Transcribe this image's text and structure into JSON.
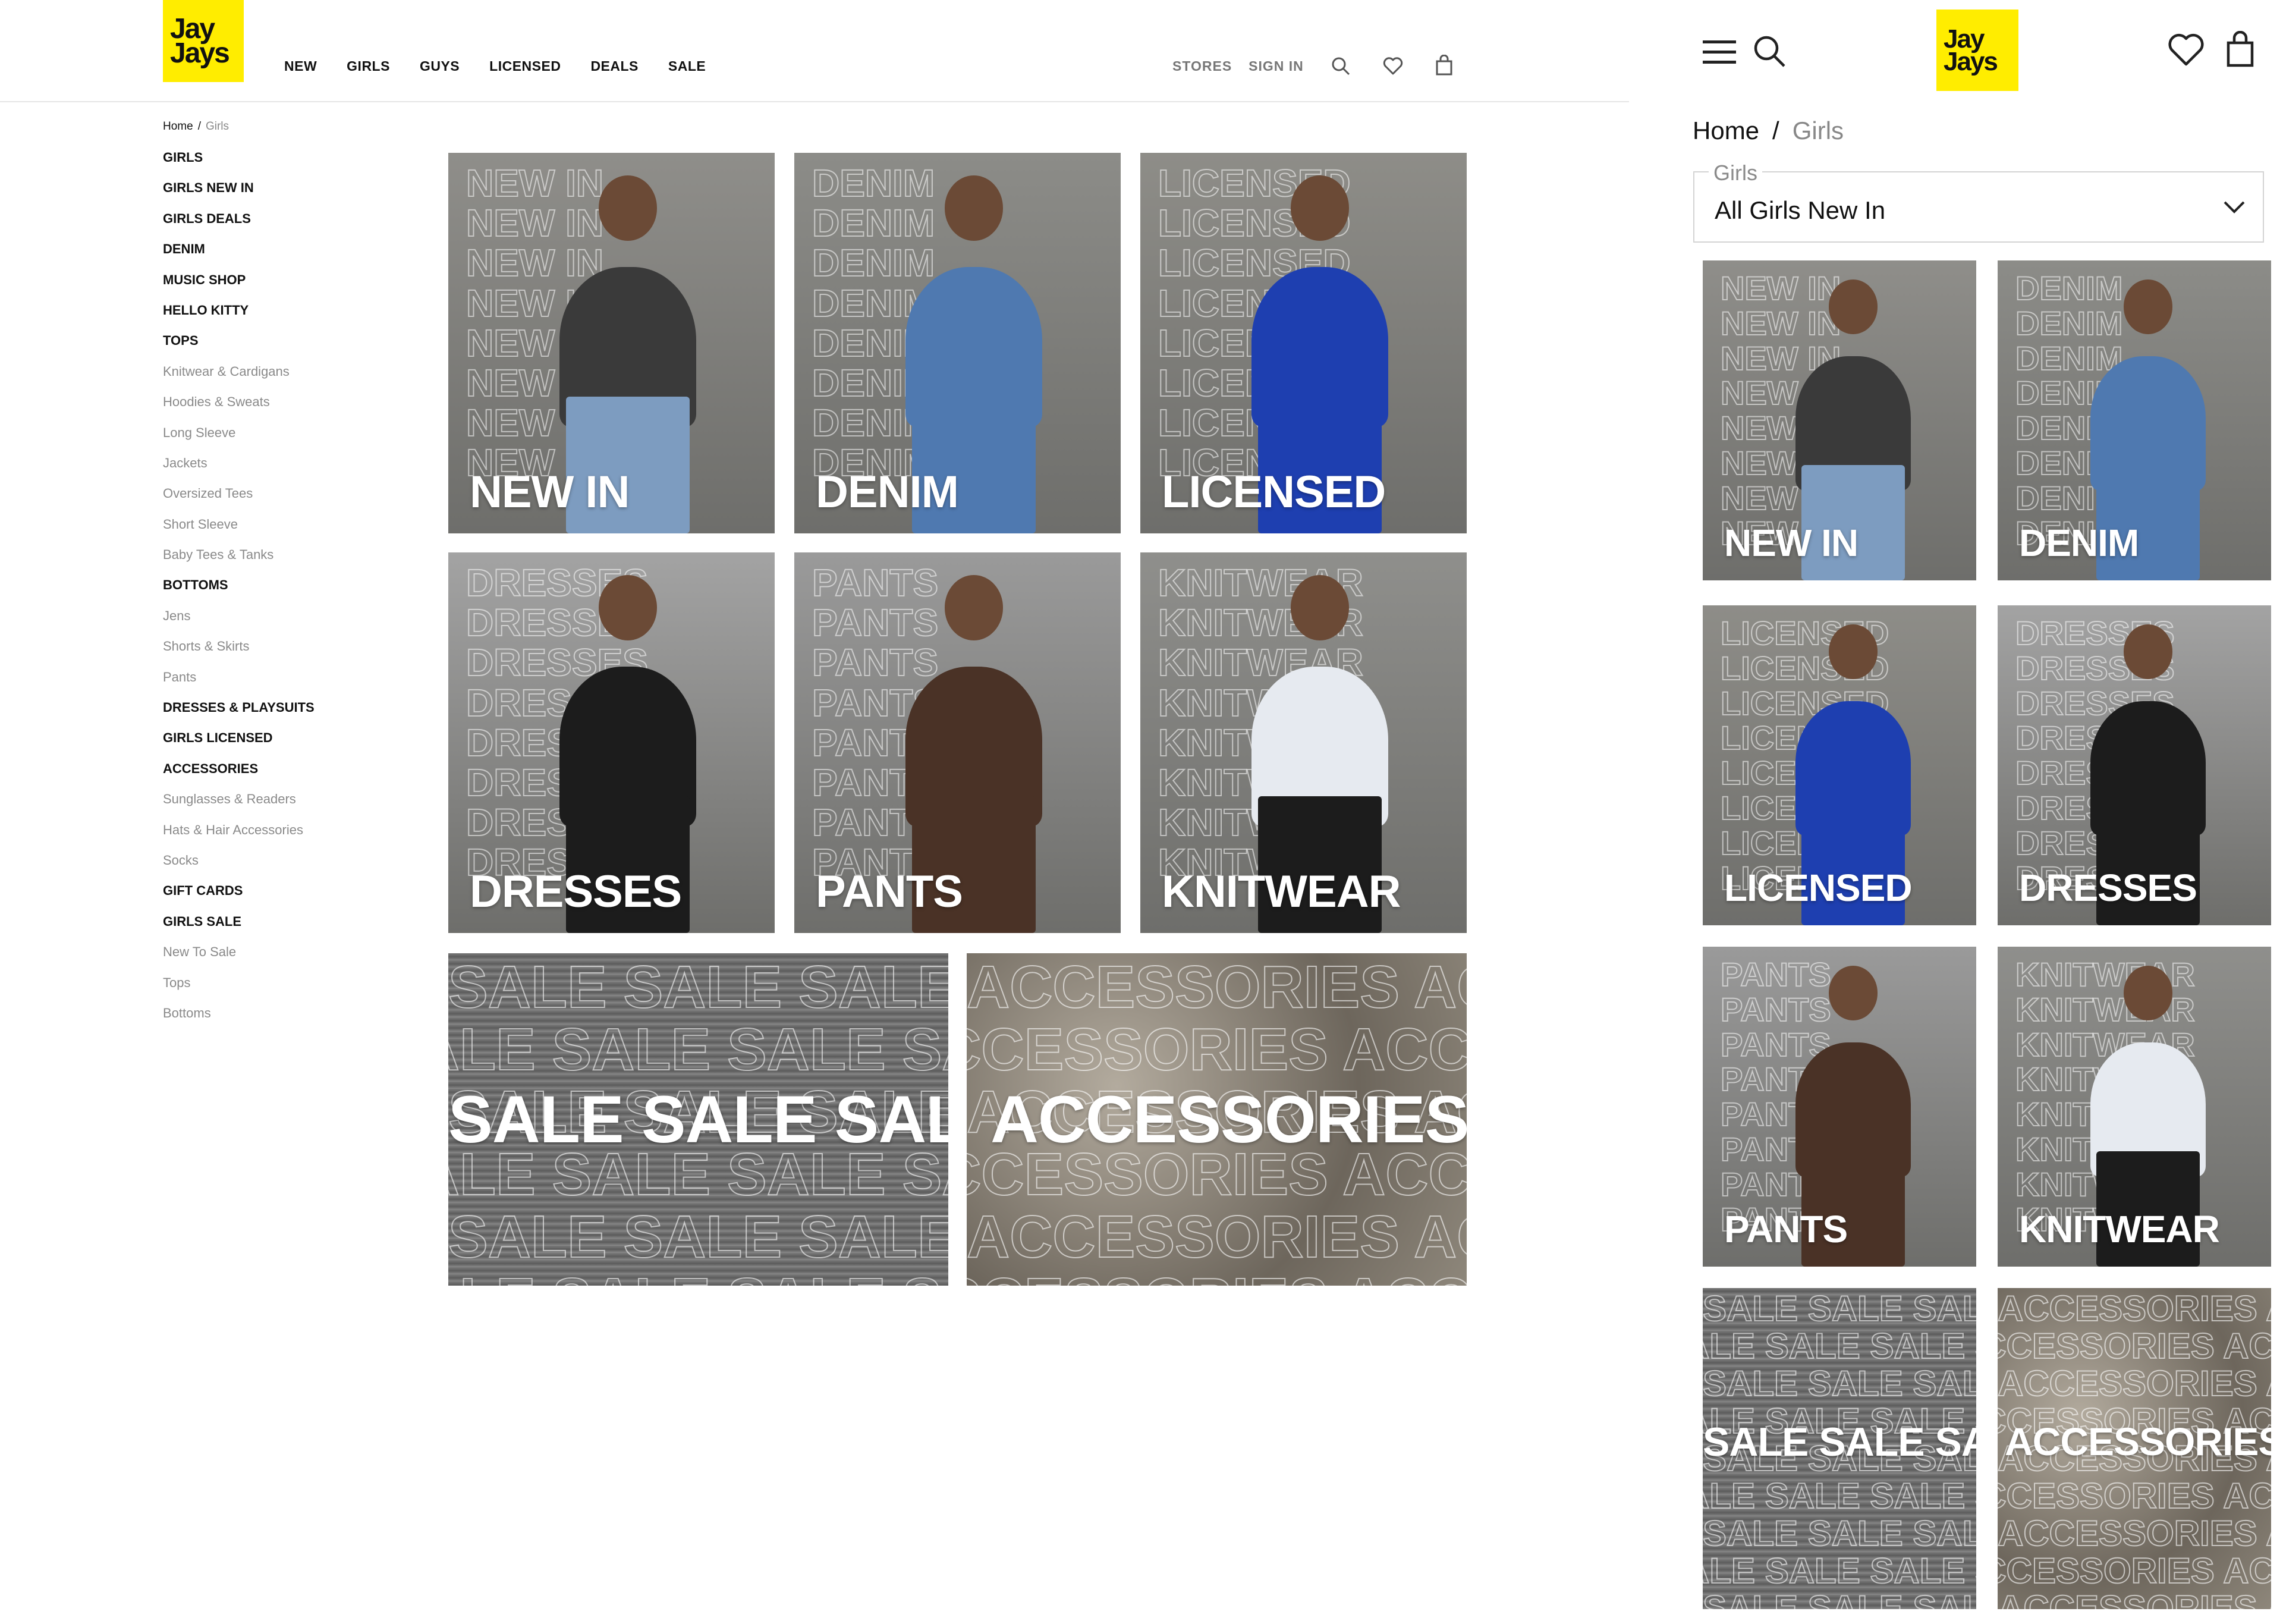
{
  "brand": {
    "logo_line1": "Jay",
    "logo_line2": "Jays",
    "accent": "#ffed00"
  },
  "desktop": {
    "nav": [
      "NEW",
      "GIRLS",
      "GUYS",
      "LICENSED",
      "DEALS",
      "SALE"
    ],
    "util": [
      "STORES",
      "SIGN IN"
    ],
    "breadcrumb": {
      "home": "Home",
      "sep": "/",
      "current": "Girls"
    },
    "sidebar": [
      {
        "label": "GIRLS",
        "type": "bold"
      },
      {
        "label": "GIRLS NEW IN",
        "type": "bold"
      },
      {
        "label": "GIRLS DEALS",
        "type": "bold"
      },
      {
        "label": "DENIM",
        "type": "bold"
      },
      {
        "label": "MUSIC SHOP",
        "type": "bold"
      },
      {
        "label": "HELLO KITTY",
        "type": "bold"
      },
      {
        "label": "TOPS",
        "type": "bold"
      },
      {
        "label": "Knitwear & Cardigans",
        "type": "sub"
      },
      {
        "label": "Hoodies & Sweats",
        "type": "sub"
      },
      {
        "label": "Long Sleeve",
        "type": "sub"
      },
      {
        "label": "Jackets",
        "type": "sub"
      },
      {
        "label": "Oversized Tees",
        "type": "sub"
      },
      {
        "label": "Short Sleeve",
        "type": "sub"
      },
      {
        "label": "Baby Tees & Tanks",
        "type": "sub"
      },
      {
        "label": "BOTTOMS",
        "type": "bold"
      },
      {
        "label": "Jens",
        "type": "sub"
      },
      {
        "label": "Shorts & Skirts",
        "type": "sub"
      },
      {
        "label": "Pants",
        "type": "sub"
      },
      {
        "label": "DRESSES & PLAYSUITS",
        "type": "bold"
      },
      {
        "label": "GIRLS LICENSED",
        "type": "bold"
      },
      {
        "label": "ACCESSORIES",
        "type": "bold"
      },
      {
        "label": "Sunglasses & Readers",
        "type": "sub"
      },
      {
        "label": "Hats & Hair Accessories",
        "type": "sub"
      },
      {
        "label": "Socks",
        "type": "sub"
      },
      {
        "label": "GIFT CARDS",
        "type": "bold"
      },
      {
        "label": "GIRLS SALE",
        "type": "bold"
      },
      {
        "label": "New To Sale",
        "type": "sub"
      },
      {
        "label": "Tops",
        "type": "sub"
      },
      {
        "label": "Bottoms",
        "type": "sub"
      }
    ]
  },
  "tiles": [
    {
      "label": "NEW IN",
      "bg": "#8f8e8a",
      "garment": "#3a3a3a",
      "lower": "#7d9cc0",
      "word": "NEW IN"
    },
    {
      "label": "DENIM",
      "bg": "#8c8c88",
      "garment": "#4f79b0",
      "lower": "#4f79b0",
      "word": "DENIM"
    },
    {
      "label": "LICENSED",
      "bg": "#8e8d88",
      "garment": "#1e3fb0",
      "lower": "#1e3fb0",
      "word": "LICENSED"
    },
    {
      "label": "DRESSES",
      "bg": "#a3a3a3",
      "garment": "#1c1c1c",
      "lower": "#1c1c1c",
      "word": "DRESSES"
    },
    {
      "label": "PANTS",
      "bg": "#9a9a9a",
      "garment": "#4a3226",
      "lower": "#4a3226",
      "word": "PANTS"
    },
    {
      "label": "KNITWEAR",
      "bg": "#8f8f8c",
      "garment": "#e6eaf0",
      "lower": "#1c1c1c",
      "word": "KNITWEAR"
    }
  ],
  "wide_tiles": [
    {
      "label": "SALE SALE SALE",
      "word": "SALE SALE SALE SALE",
      "bg": "#6c6c6c"
    },
    {
      "label": "ACCESSORIES",
      "word": "ACCESSORIES ACCESSORIES",
      "bg": "#8a8378"
    }
  ],
  "mobile": {
    "breadcrumb": {
      "home": "Home",
      "sep": "/",
      "current": "Girls"
    },
    "select": {
      "legend": "Girls",
      "value": "All Girls New In"
    }
  }
}
